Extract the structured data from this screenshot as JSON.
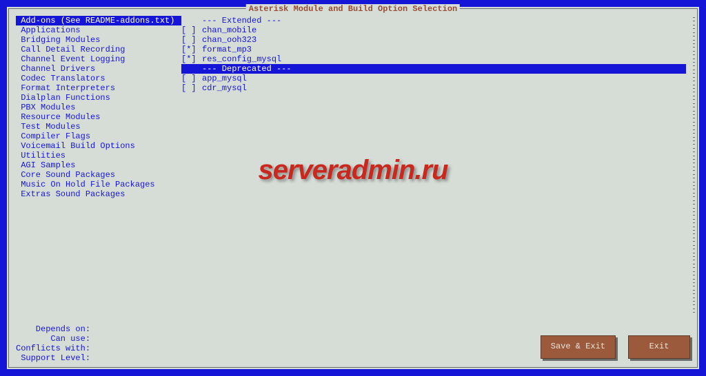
{
  "title": "Asterisk Module and Build Option Selection",
  "watermark": "serveradmin.ru",
  "categories": [
    {
      "label": "Add-ons (See README-addons.txt)",
      "selected": true
    },
    {
      "label": "Applications",
      "selected": false
    },
    {
      "label": "Bridging Modules",
      "selected": false
    },
    {
      "label": "Call Detail Recording",
      "selected": false
    },
    {
      "label": "Channel Event Logging",
      "selected": false
    },
    {
      "label": "Channel Drivers",
      "selected": false
    },
    {
      "label": "Codec Translators",
      "selected": false
    },
    {
      "label": "Format Interpreters",
      "selected": false
    },
    {
      "label": "Dialplan Functions",
      "selected": false
    },
    {
      "label": "PBX Modules",
      "selected": false
    },
    {
      "label": "Resource Modules",
      "selected": false
    },
    {
      "label": "Test Modules",
      "selected": false
    },
    {
      "label": "Compiler Flags",
      "selected": false
    },
    {
      "label": "Voicemail Build Options",
      "selected": false
    },
    {
      "label": "Utilities",
      "selected": false
    },
    {
      "label": "AGI Samples",
      "selected": false
    },
    {
      "label": "Core Sound Packages",
      "selected": false
    },
    {
      "label": "Music On Hold File Packages",
      "selected": false
    },
    {
      "label": "Extras Sound Packages",
      "selected": false
    }
  ],
  "modules": [
    {
      "type": "header",
      "label": "--- Extended ---",
      "highlighted": false
    },
    {
      "type": "item",
      "marker": "[ ]",
      "name": "chan_mobile"
    },
    {
      "type": "item",
      "marker": "[ ]",
      "name": "chan_ooh323"
    },
    {
      "type": "item",
      "marker": "[*]",
      "name": "format_mp3"
    },
    {
      "type": "item",
      "marker": "[*]",
      "name": "res_config_mysql"
    },
    {
      "type": "header",
      "label": "--- Deprecated ---",
      "highlighted": true
    },
    {
      "type": "item",
      "marker": "[ ]",
      "name": "app_mysql"
    },
    {
      "type": "item",
      "marker": "[ ]",
      "name": "cdr_mysql"
    }
  ],
  "info": {
    "depends": "    Depends on:",
    "canuse": "       Can use:",
    "conflicts": "Conflicts with:",
    "support": " Support Level:"
  },
  "buttons": {
    "save": "Save & Exit",
    "exit": "Exit"
  }
}
